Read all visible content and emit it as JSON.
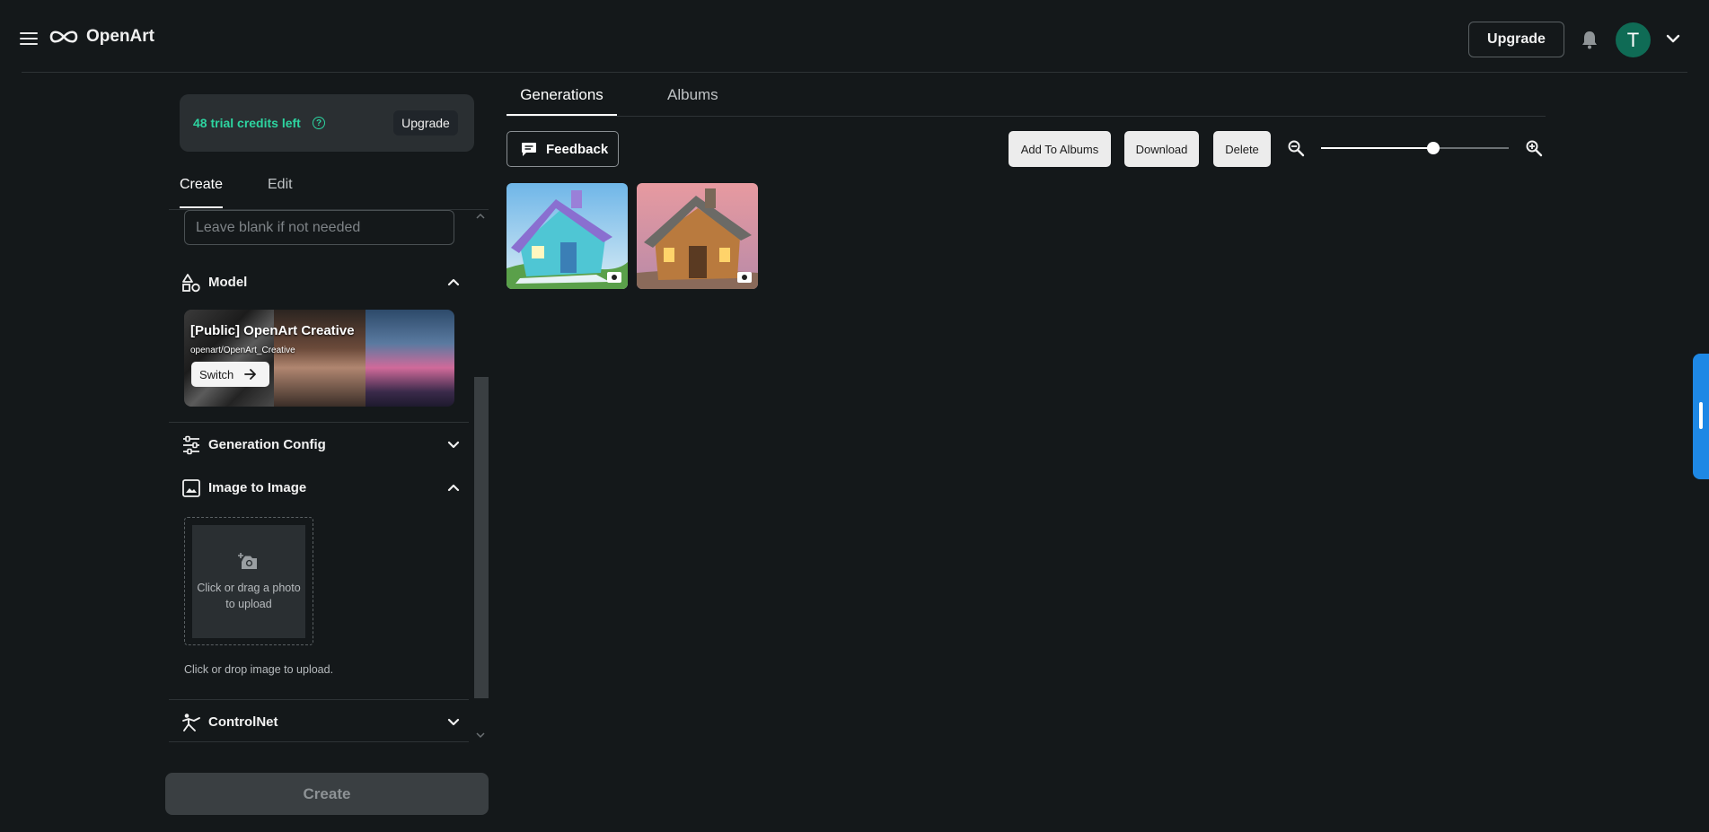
{
  "header": {
    "brand": "OpenArt",
    "upgrade_label": "Upgrade",
    "avatar_initial": "T"
  },
  "credits": {
    "text": "48 trial credits left",
    "help_glyph": "?",
    "upgrade_label": "Upgrade"
  },
  "panel_tabs": {
    "create": "Create",
    "edit": "Edit"
  },
  "prompt_field": {
    "placeholder": "Leave blank if not needed",
    "value": ""
  },
  "sections": {
    "model": "Model",
    "generation_config": "Generation Config",
    "image_to_image": "Image to Image",
    "controlnet": "ControlNet"
  },
  "model": {
    "name": "[Public] OpenArt Creative",
    "path": "openart/OpenArt_Creative",
    "switch_label": "Switch"
  },
  "upload": {
    "box_text": "Click or drag a photo to upload",
    "hint": "Click or drop image to upload."
  },
  "create_button": "Create",
  "main_tabs": {
    "generations": "Generations",
    "albums": "Albums"
  },
  "toolbar": {
    "feedback": "Feedback",
    "add_to_albums": "Add To Albums",
    "download": "Download",
    "delete": "Delete",
    "zoom_level": 0.6
  },
  "colors": {
    "accent_green": "#2dd4a0",
    "avatar_bg": "#0f6b55",
    "side_tab_blue": "#1e88e5",
    "background": "#14181a"
  },
  "icons": {
    "menu": "menu-icon",
    "bell": "bell-icon",
    "camera": "camera-plus-icon",
    "zoom_in": "zoom-in-icon",
    "zoom_out": "zoom-out-icon"
  }
}
